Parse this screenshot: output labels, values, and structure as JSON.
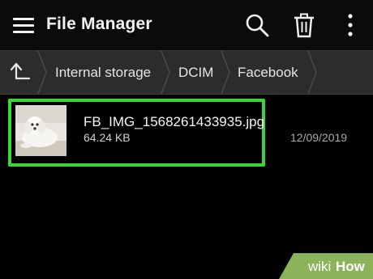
{
  "appbar": {
    "title": "File Manager",
    "icons": [
      "menu-icon",
      "search-icon",
      "trash-icon",
      "more-vert-icon"
    ]
  },
  "pathbar": {
    "up_icon": "up-arrow-icon",
    "crumbs": [
      "Internal storage",
      "DCIM",
      "Facebook"
    ]
  },
  "file": {
    "name": "FB_IMG_1568261433935.jpg",
    "size": "64.24 KB",
    "date": "12/09/2019",
    "thumbnail_icon": "dog-photo-thumbnail"
  },
  "colors": {
    "highlight": "#3ed53a",
    "appbar_bg": "#0b0b0b",
    "pathbar_bg": "#2c2c2c"
  },
  "watermark": {
    "brand": "wikiHow"
  }
}
